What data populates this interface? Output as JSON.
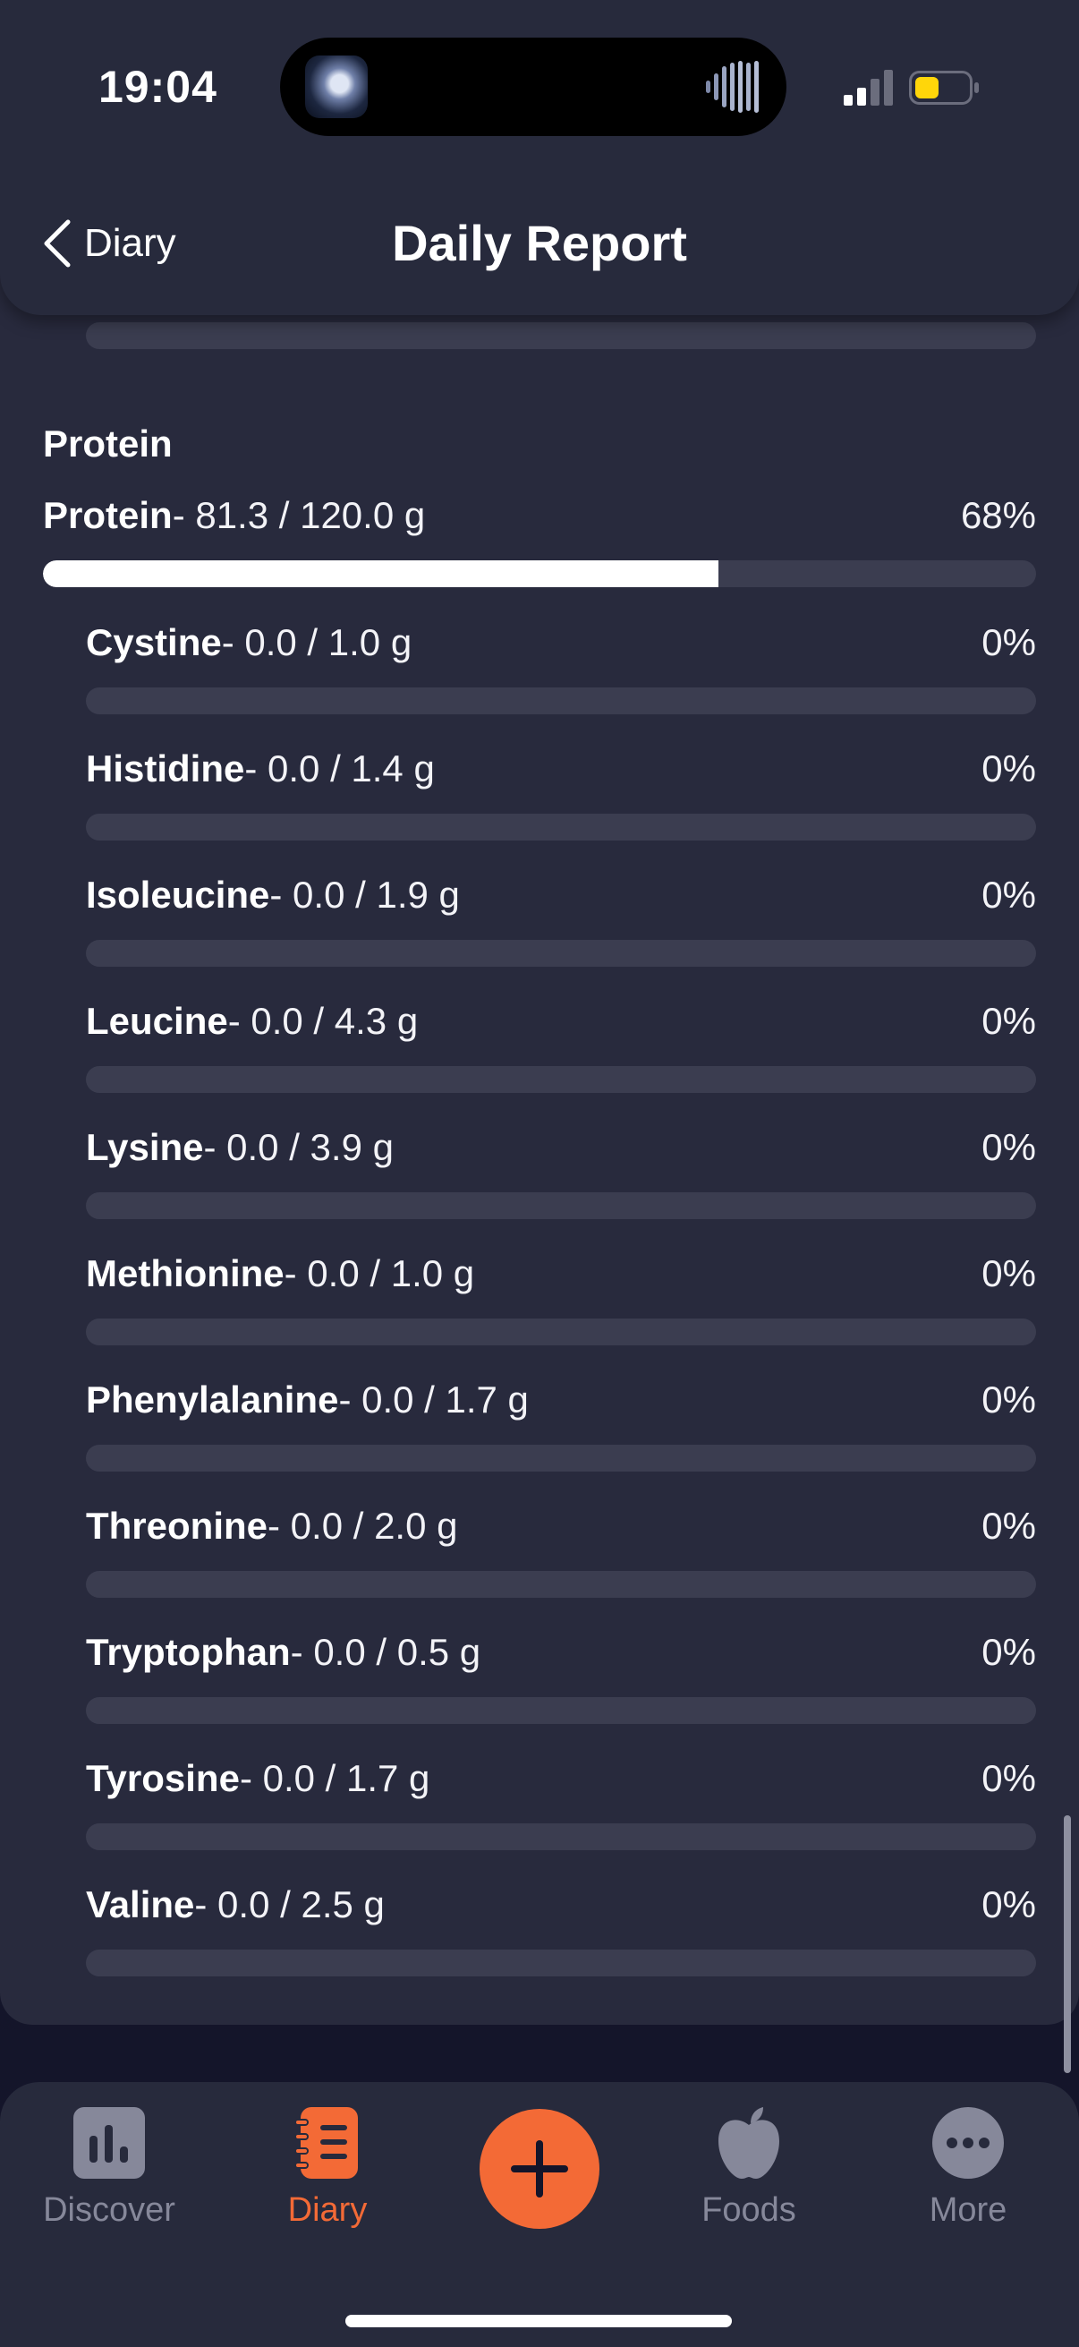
{
  "status_bar": {
    "time": "19:04"
  },
  "header": {
    "back_label": "Diary",
    "title": "Daily Report"
  },
  "section": {
    "title": "Protein"
  },
  "main_row": {
    "name": "Protein",
    "amount": "- 81.3 / 120.0 g",
    "percent": "68%",
    "fraction": 0.68
  },
  "rows": [
    {
      "name": "Cystine",
      "amount": "- 0.0 / 1.0 g",
      "percent": "0%",
      "fraction": 0
    },
    {
      "name": "Histidine",
      "amount": "- 0.0 / 1.4 g",
      "percent": "0%",
      "fraction": 0
    },
    {
      "name": "Isoleucine",
      "amount": "- 0.0 / 1.9 g",
      "percent": "0%",
      "fraction": 0
    },
    {
      "name": "Leucine",
      "amount": "- 0.0 / 4.3 g",
      "percent": "0%",
      "fraction": 0
    },
    {
      "name": "Lysine",
      "amount": "- 0.0 / 3.9 g",
      "percent": "0%",
      "fraction": 0
    },
    {
      "name": "Methionine",
      "amount": "- 0.0 / 1.0 g",
      "percent": "0%",
      "fraction": 0
    },
    {
      "name": "Phenylalanine",
      "amount": "- 0.0 / 1.7 g",
      "percent": "0%",
      "fraction": 0
    },
    {
      "name": "Threonine",
      "amount": "- 0.0 / 2.0 g",
      "percent": "0%",
      "fraction": 0
    },
    {
      "name": "Tryptophan",
      "amount": "- 0.0 / 0.5 g",
      "percent": "0%",
      "fraction": 0
    },
    {
      "name": "Tyrosine",
      "amount": "- 0.0 / 1.7 g",
      "percent": "0%",
      "fraction": 0
    },
    {
      "name": "Valine",
      "amount": "- 0.0 / 2.5 g",
      "percent": "0%",
      "fraction": 0
    }
  ],
  "tab_bar": {
    "tabs": [
      {
        "label": "Discover",
        "icon": "bar-chart-icon",
        "active": false
      },
      {
        "label": "Diary",
        "icon": "notebook-icon",
        "active": true
      },
      {
        "label": "Foods",
        "icon": "apple-icon",
        "active": false
      },
      {
        "label": "More",
        "icon": "ellipsis-icon",
        "active": false
      }
    ],
    "add_icon": "plus-icon"
  },
  "colors": {
    "accent": "#f36a36",
    "track": "#3b3d50",
    "fill": "#ffffff",
    "card": "#282a3d",
    "background": "#14152a"
  }
}
